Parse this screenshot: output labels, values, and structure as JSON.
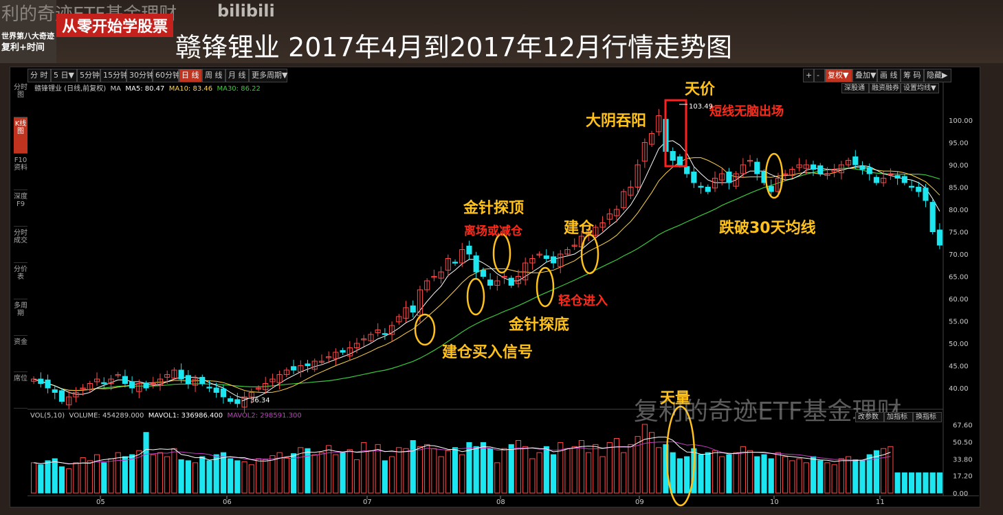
{
  "header": {
    "watermark_top": "利的奇迹ETF基金理财",
    "logo_text": "bilibili",
    "badge": "从零开始学股票",
    "avatar_line1": "世界第八大奇迹",
    "avatar_line2": "复利+时间",
    "title": "赣锋锂业 2017年4月到2017年12月行情走势图"
  },
  "toolbar": {
    "periods": [
      "分 时",
      "5 日▼",
      "5分钟",
      "15分钟",
      "30分钟",
      "60分钟",
      "日 线",
      "周 线",
      "月 线",
      "更多周期▼"
    ],
    "right": [
      "+",
      "-",
      "复权▼",
      "叠加▼",
      "画 线",
      "筹 码",
      "隐藏▶"
    ],
    "sub": [
      "深股通",
      "融资融券",
      "设置均线▼"
    ]
  },
  "sidebar": [
    "分时图",
    "K线图",
    "F10资料",
    "深度F9",
    "分时成交",
    "分价表",
    "多周期",
    "资金",
    "席位"
  ],
  "ma_line": {
    "name": "赣锋锂业 (日线,前复权)",
    "ma": "MA",
    "ma5": "MA5: 80.47",
    "ma10": "MA10: 83.46",
    "ma30": "MA30: 86.22"
  },
  "vol_line": {
    "label": "VOL(5,10)",
    "volume": "VOLUME: 454289.000",
    "mavol1": "MAVOL1: 336986.400",
    "mavol2": "MAVOL2: 298591.300",
    "buttons": [
      "改参数",
      "加指标",
      "换指标"
    ]
  },
  "annotations": {
    "tianjia": "天价",
    "dayin": "大阴吞阳",
    "duanxian": "短线无脑出场",
    "jinzhen_ding": "金针探顶",
    "lichang": "离场或减仓",
    "jiancang": "建仓",
    "qingcang": "轻仓进入",
    "jinzhen_di": "金针探底",
    "jiancang_signal": "建仓买入信号",
    "diepo": "跌破30天均线",
    "tianliang": "天量",
    "high_label": "103.49",
    "low_label": "36.34"
  },
  "watermark": "复利的奇迹ETF基金理财",
  "colors": {
    "up": "#ff4a4a",
    "down": "#1ce6f0",
    "ma5": "#ffffff",
    "ma10": "#ffd24a",
    "ma30": "#3cc83c",
    "mavol2": "#c040c0"
  },
  "chart_data": {
    "type": "candlestick",
    "ylim": [
      36,
      104
    ],
    "y_ticks": [
      "100.00",
      "95.00",
      "90.00",
      "85.00",
      "80.00",
      "75.00",
      "70.00",
      "65.00",
      "60.00",
      "55.00",
      "50.00",
      "45.00",
      "40.00"
    ],
    "vol_ticks": [
      "67.60",
      "50.50",
      "33.80",
      "17.20",
      "0.00"
    ],
    "vol_unit": "万",
    "x_months": [
      "05",
      "06",
      "07",
      "08",
      "09",
      "10",
      "11"
    ],
    "closes": [
      42,
      41,
      40,
      39,
      37,
      38,
      39,
      40,
      41,
      42,
      41,
      42,
      43,
      41,
      40,
      41,
      40,
      41,
      42,
      43,
      44,
      42,
      41,
      42,
      41,
      40,
      39,
      38,
      37,
      36.5,
      38,
      39,
      40,
      41,
      42,
      43,
      44,
      44,
      45,
      45,
      46,
      46,
      47,
      48,
      48,
      49,
      50,
      51,
      52,
      53,
      52,
      54,
      56,
      58,
      57,
      62,
      64,
      65,
      66,
      69,
      68,
      71,
      70,
      66,
      65,
      63,
      64,
      65,
      63,
      65,
      68,
      69,
      70,
      69,
      68,
      70,
      71,
      72,
      74,
      75,
      76,
      77,
      79,
      80,
      84,
      85,
      90,
      95,
      97,
      101,
      93,
      91,
      90,
      88,
      86,
      85,
      84,
      87,
      88,
      86,
      88,
      90,
      91,
      88,
      86,
      84,
      87,
      88,
      89,
      90,
      90,
      89,
      88,
      88,
      89,
      90,
      91,
      90,
      89,
      88,
      86,
      87,
      88,
      87,
      86,
      85,
      84,
      82,
      75,
      72
    ],
    "volumes": [
      30,
      28,
      32,
      34,
      26,
      24,
      30,
      35,
      32,
      38,
      30,
      34,
      40,
      36,
      38,
      42,
      60,
      38,
      40,
      36,
      44,
      33,
      32,
      30,
      36,
      32,
      38,
      40,
      34,
      32,
      31,
      28,
      34,
      33,
      37,
      40,
      35,
      39,
      45,
      44,
      38,
      40,
      47,
      38,
      40,
      43,
      33,
      50,
      42,
      48,
      32,
      36,
      45,
      44,
      52,
      46,
      48,
      44,
      36,
      42,
      45,
      38,
      50,
      46,
      50,
      44,
      30,
      44,
      48,
      52,
      46,
      34,
      40,
      46,
      38,
      50,
      44,
      46,
      52,
      40,
      48,
      36,
      50,
      54,
      40,
      48,
      56,
      68,
      60,
      45,
      48,
      40,
      34,
      36,
      44,
      38,
      40,
      42,
      36,
      38,
      40,
      46,
      42,
      36,
      38,
      34,
      40,
      36,
      32,
      34,
      30,
      36,
      32,
      30,
      28,
      34,
      36,
      33,
      32,
      38,
      42,
      44,
      46
    ]
  }
}
